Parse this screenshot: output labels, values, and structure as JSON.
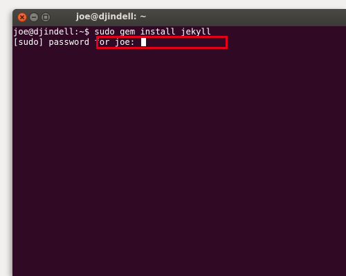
{
  "window": {
    "title": "joe@djindell: ~"
  },
  "terminal": {
    "prompt": "joe@djindell:~$ ",
    "command": "sudo gem install jekyll",
    "password_prompt": "[sudo] password for joe: "
  },
  "colors": {
    "terminal_bg": "#300a24",
    "highlight": "#e2001a",
    "titlebar": "#3e3d39"
  },
  "icons": [
    "close-icon",
    "minimize-icon",
    "maximize-icon"
  ]
}
